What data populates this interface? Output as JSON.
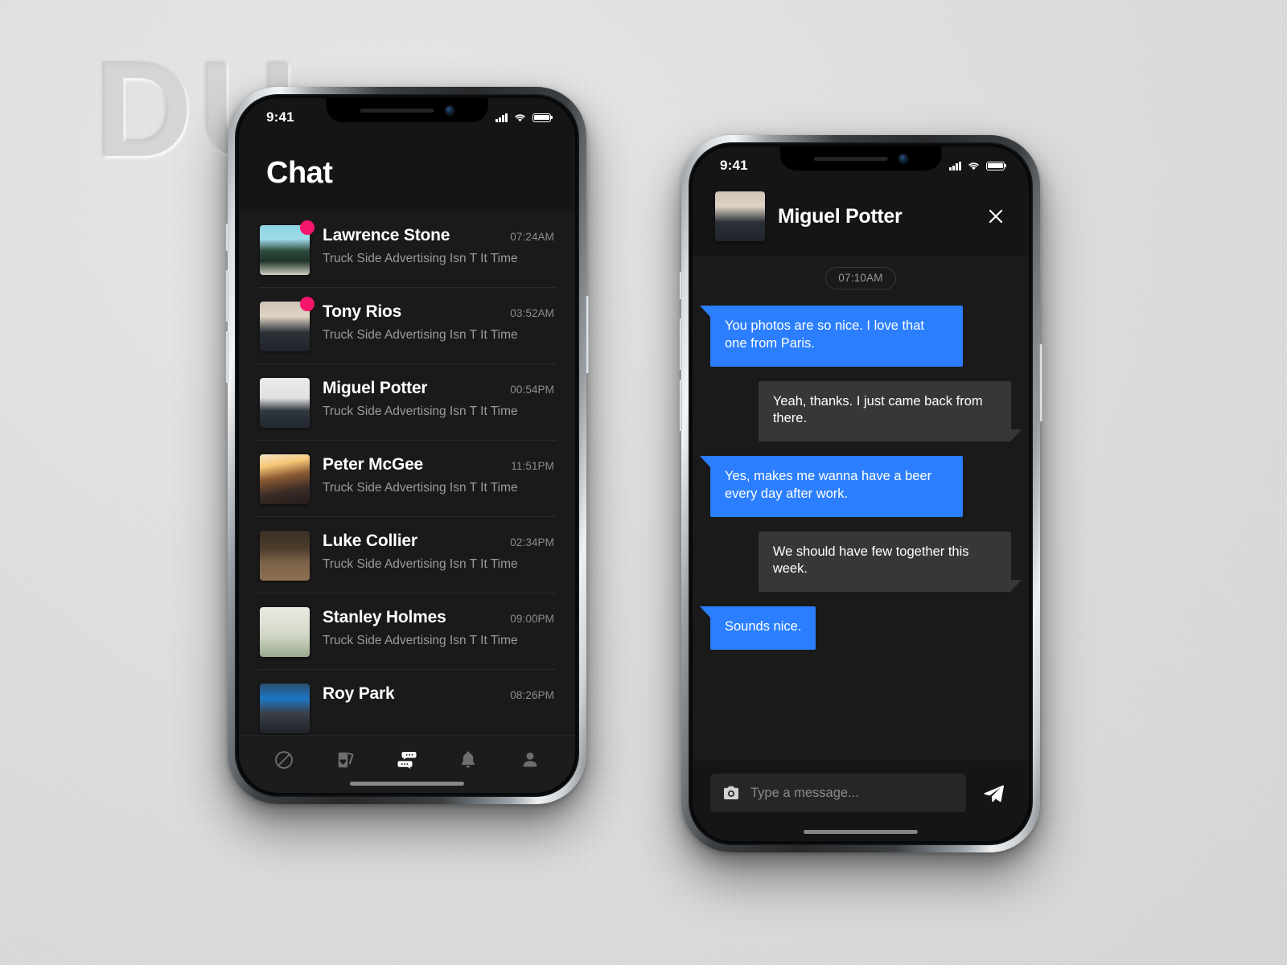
{
  "scene": {
    "watermark_text": "DU",
    "background_color": "#e4e4e4"
  },
  "colors": {
    "accent_blue": "#2b7fff",
    "badge_pink": "#f5156b",
    "screen_bg": "#1a1a1a",
    "header_bg": "#151515",
    "incoming_bubble": "#373737"
  },
  "phone_list": {
    "status_bar": {
      "time": "9:41"
    },
    "page_title": "Chat",
    "conversations": [
      {
        "name": "Lawrence Stone",
        "time": "07:24AM",
        "preview": "Truck Side Advertising Isn T It Time",
        "unread": true,
        "avatar_class": "av-lawrence"
      },
      {
        "name": "Tony Rios",
        "time": "03:52AM",
        "preview": "Truck Side Advertising Isn T It Time",
        "unread": true,
        "avatar_class": "av-tony"
      },
      {
        "name": "Miguel Potter",
        "time": "00:54PM",
        "preview": "Truck Side Advertising Isn T It Time",
        "unread": false,
        "avatar_class": "av-miguel"
      },
      {
        "name": "Peter McGee",
        "time": "11:51PM",
        "preview": "Truck Side Advertising Isn T It Time",
        "unread": false,
        "avatar_class": "av-peter"
      },
      {
        "name": "Luke Collier",
        "time": "02:34PM",
        "preview": "Truck Side Advertising Isn T It Time",
        "unread": false,
        "avatar_class": "av-luke"
      },
      {
        "name": "Stanley Holmes",
        "time": "09:00PM",
        "preview": "Truck Side Advertising Isn T It Time",
        "unread": false,
        "avatar_class": "av-stanley"
      },
      {
        "name": "Roy Park",
        "time": "08:26PM",
        "preview": "",
        "unread": false,
        "avatar_class": "av-roy"
      }
    ],
    "tabbar": [
      {
        "icon": "prohibited-circle-icon",
        "label": "Nope",
        "active": false
      },
      {
        "icon": "card-deck-heart-icon",
        "label": "Matches",
        "active": false
      },
      {
        "icon": "chat-bubbles-icon",
        "label": "Chat",
        "active": true
      },
      {
        "icon": "bell-icon",
        "label": "Notifications",
        "active": false
      },
      {
        "icon": "person-icon",
        "label": "Profile",
        "active": false
      }
    ]
  },
  "phone_chat": {
    "status_bar": {
      "time": "9:41"
    },
    "header": {
      "name": "Miguel Potter",
      "close_label": "✕",
      "avatar_class": "av-tony"
    },
    "time_divider": "07:10AM",
    "messages": [
      {
        "side": "out",
        "text": "You photos are so nice. I love that one from Paris."
      },
      {
        "side": "in",
        "text": "Yeah, thanks. I just came back from there."
      },
      {
        "side": "out",
        "text": "Yes, makes me wanna have a beer every day after work."
      },
      {
        "side": "in",
        "text": "We should have few together this week."
      },
      {
        "side": "out",
        "text": "Sounds nice."
      }
    ],
    "composer": {
      "input_value": "",
      "placeholder": "Type a message...",
      "camera_icon": "camera-icon",
      "send_icon": "send-paper-plane-icon"
    }
  }
}
